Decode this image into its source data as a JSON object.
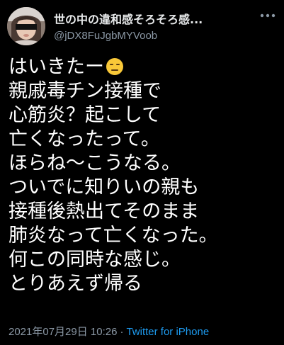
{
  "tweet": {
    "author": {
      "display_name": "世の中の違和感そろそろ感...",
      "handle": "@jDX8FuJgbMYVoob",
      "avatar_icon": "profile-photo"
    },
    "more_icon": "more-horizontal-icon",
    "lines": [
      "はいきたー",
      "親戚毒チン接種で",
      "心筋炎？起こして",
      "亡くなったって。",
      "ほらね〜こうなる。",
      "ついでに知りいの親も",
      "接種後熱出てそのまま",
      "肺炎なって亡くなった。",
      "何この同時な感じ。",
      "とりあえず帰る"
    ],
    "first_line_emoji": "expressionless-face-emoji",
    "timestamp": "2021年07月29日 10:26",
    "separator": "·",
    "source": "Twitter for iPhone",
    "colors": {
      "background": "#000000",
      "text": "#ffffff",
      "secondary": "#8b98a5",
      "link": "#1d9bf0"
    }
  }
}
